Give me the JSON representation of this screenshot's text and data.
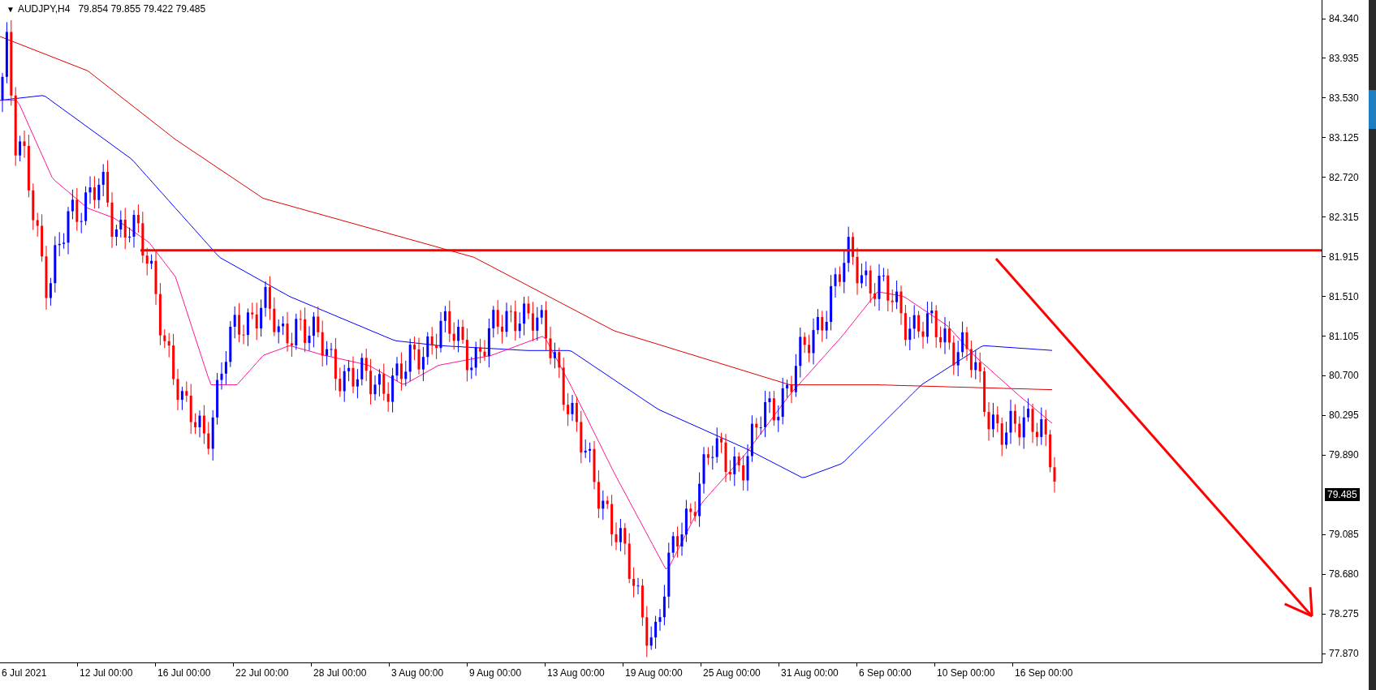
{
  "header": {
    "menu_triangle": "▼",
    "symbol": "AUDJPY,H4",
    "ohlc": "79.854 79.855 79.422 79.485"
  },
  "price_axis": {
    "ticks": [
      "84.340",
      "83.935",
      "83.530",
      "83.125",
      "82.720",
      "82.315",
      "81.915",
      "81.510",
      "81.105",
      "80.700",
      "80.295",
      "79.890",
      "79.085",
      "78.680",
      "78.275",
      "77.870"
    ],
    "current_price": "79.485"
  },
  "time_axis": {
    "labels": [
      "6 Jul 2021",
      "12 Jul 00:00",
      "16 Jul 00:00",
      "22 Jul 00:00",
      "28 Jul 00:00",
      "3 Aug 00:00",
      "9 Aug 00:00",
      "13 Aug 00:00",
      "19 Aug 00:00",
      "25 Aug 00:00",
      "31 Aug 00:00",
      "6 Sep 00:00",
      "10 Sep 00:00",
      "16 Sep 00:00"
    ]
  }
}
